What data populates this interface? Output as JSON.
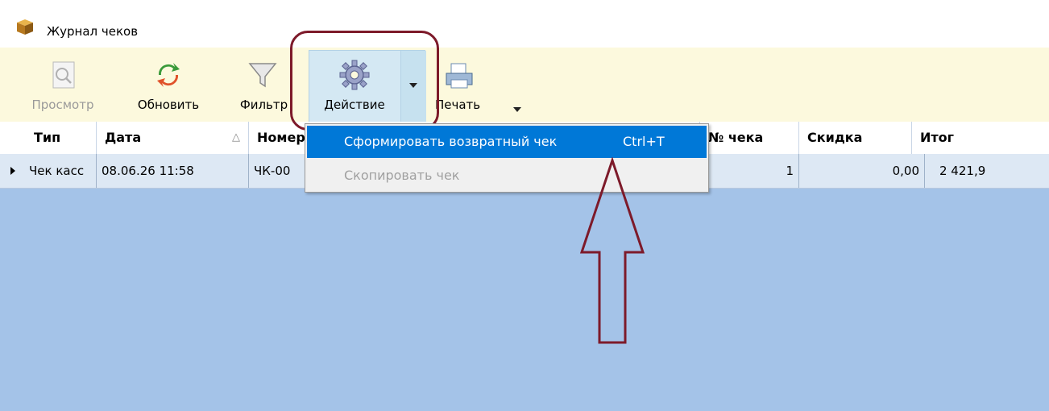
{
  "window": {
    "title": "Журнал чеков",
    "title_icon": "box-icon"
  },
  "toolbar": {
    "view_label": "Просмотр",
    "refresh_label": "Обновить",
    "filter_label": "Фильтр",
    "action_label": "Действие",
    "print_label": "Печать"
  },
  "grid": {
    "columns": [
      "Тип",
      "Дата",
      "Номер",
      "№ чека",
      "Скидка",
      "Итог"
    ],
    "sort_indicator": "△",
    "rows": [
      {
        "type": "Чек касс",
        "date": "08.06.26 11:58",
        "number": "ЧК-00",
        "check_no": "1",
        "discount": "0,00",
        "total": "2 421,9"
      }
    ]
  },
  "menu": {
    "items": [
      {
        "label": "Сформировать возвратный чек",
        "shortcut": "Ctrl+T",
        "state": "highlighted"
      },
      {
        "label": "Скопировать чек",
        "shortcut": "",
        "state": "disabled"
      }
    ]
  },
  "colors": {
    "toolbar_bg": "#fcf9dd",
    "grid_bg": "#a4c3e8",
    "menu_highlight": "#0078d7",
    "annotation": "#7d1a2a"
  }
}
